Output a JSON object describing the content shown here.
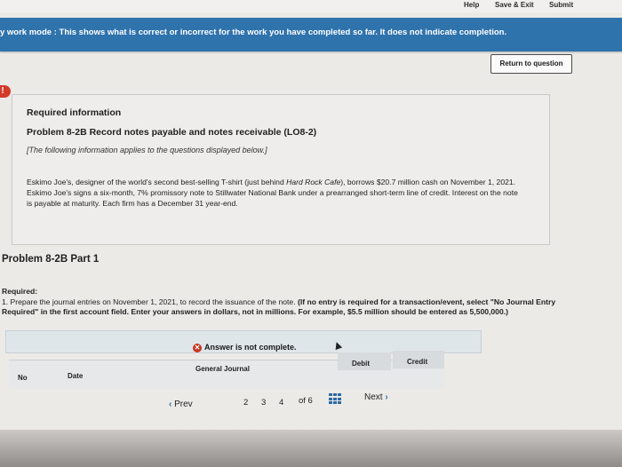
{
  "topbar": {
    "help": "Help",
    "save_exit": "Save & Exit",
    "submit": "Submit"
  },
  "mode_banner": "y work mode : This shows what is correct or incorrect for the work you have completed so far. It does not indicate completion.",
  "return_button": "Return to question",
  "alert_badge": "!",
  "info": {
    "heading": "Required information",
    "problem": "Problem 8-2B Record notes payable and notes receivable (LO8-2)",
    "note": "[The following information applies to the questions displayed below.]",
    "para_part1": "Eskimo Joe's, designer of the world's second best-selling T-shirt (just behind ",
    "para_italic": "Hard Rock Cafe",
    "para_part2": "), borrows $20.7 million cash on November 1, 2021. Eskimo Joe's signs a six-month, 7% promissory note to Stillwater National Bank under a prearranged short-term line of credit. Interest on the note is payable at maturity. Each firm has a December 31 year-end."
  },
  "part_title": "Problem 8-2B Part 1",
  "required": {
    "label": "Required:",
    "text": "1. Prepare the journal entries on November 1, 2021, to record the issuance of the note. ",
    "bold_text": "(If no entry is required for a transaction/event, select \"No Journal Entry Required\" in the first account field. Enter your answers in dollars, not in millions. For example, $5.5 million should be entered as 5,500,000.)"
  },
  "answer_status": "Answer is not complete.",
  "table": {
    "title": "General Journal",
    "columns": [
      "No",
      "Date",
      "Debit",
      "Credit"
    ]
  },
  "pagination": {
    "prev": "Prev",
    "pages": [
      "2",
      "3",
      "4"
    ],
    "of_text": "of 6",
    "next": "Next"
  },
  "colors": {
    "banner": "#2f73ad",
    "alert": "#d43a2a",
    "link": "#2d6aa4"
  }
}
